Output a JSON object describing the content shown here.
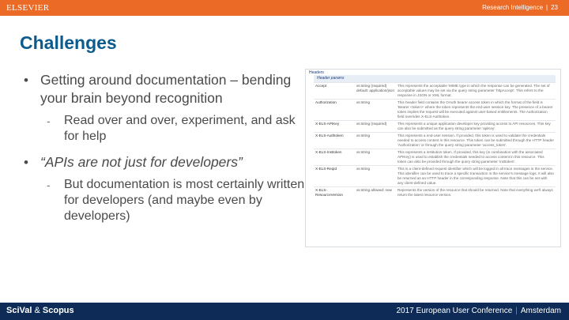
{
  "header": {
    "brand": "ELSEVIER",
    "section": "Research Intelligence",
    "page_number": "23"
  },
  "title": "Challenges",
  "bullets": [
    {
      "text": "Getting around documentation – bending your brain beyond recognition"
    },
    {
      "text": "Read over and over, experiment, and ask for help"
    },
    {
      "text": "“APIs are not just for developers”"
    },
    {
      "text": "But documentation is most certainly written for developers (and maybe even by developers)"
    }
  ],
  "bullet_marks": {
    "main": "•",
    "sub": "-"
  },
  "doc": {
    "heading": "Headers",
    "subheading": "Header params",
    "rows": [
      {
        "name": "Accept",
        "type": "xs:string (required) default: application/json",
        "desc": "This represents the acceptable 'MIME type in which the response can be generated. The set of acceptable values may be set via the query string parameter 'httpAccept'. This refers to the response in JSON or XML format."
      },
      {
        "name": "Authorization",
        "type": "xs:string",
        "desc": "This header field contains the OAuth bearer access token in which the format of the field is 'Bearer <token>' where the token represents the end-user session key. The presence of a bearer token implies the request will be executed against user-based entitlements. The Authorization field overrides X-ELS-Authtoken."
      },
      {
        "name": "X-ELS-APIKey",
        "type": "xs:string (required)",
        "desc": "This represents a unique application developer key providing access to API resources. This key can also be submitted as the query string parameter 'apiKey'."
      },
      {
        "name": "X-ELS-Authtoken",
        "type": "xs:string",
        "desc": "This represents a end-user session. If provided, this token is used to validate the credentials needed to access content in this resource. This token can be submitted through the HTTP header 'Authorization' or through the query string parameter 'access_token'."
      },
      {
        "name": "X-ELS-Insttoken",
        "type": "xs:string",
        "desc": "This represents a institution token. If provided, this key (in combination with the associated APIKey) is used to establish the credentials needed to access content in this resource. This token can also be provided through the query string parameter 'insttoken'."
      },
      {
        "name": "X-ELS-ReqId",
        "type": "xs:string",
        "desc": "This is a client-defined request identifier which will be logged in all trace messages in the service. This identifier can be used to trace a specific transaction in the service's message logs. It will also be returned as an HTTP header in the corresponding response. Note that this can be set with any client-defined value."
      },
      {
        "name": "X-ELS-ResourceVersion",
        "type": "xs:string allowed: new",
        "desc": "Represents the version of the resource that should be returned. Note that everything we'll always return the latest resource version."
      }
    ]
  },
  "footer": {
    "logo_left": "SciVal",
    "logo_amp": "&",
    "logo_right": "Scopus",
    "conference": "2017 European User Conference",
    "location": "Amsterdam"
  },
  "colors": {
    "topbar": "#ea6a26",
    "title": "#0b5b8f",
    "footer": "#0d2b56"
  }
}
